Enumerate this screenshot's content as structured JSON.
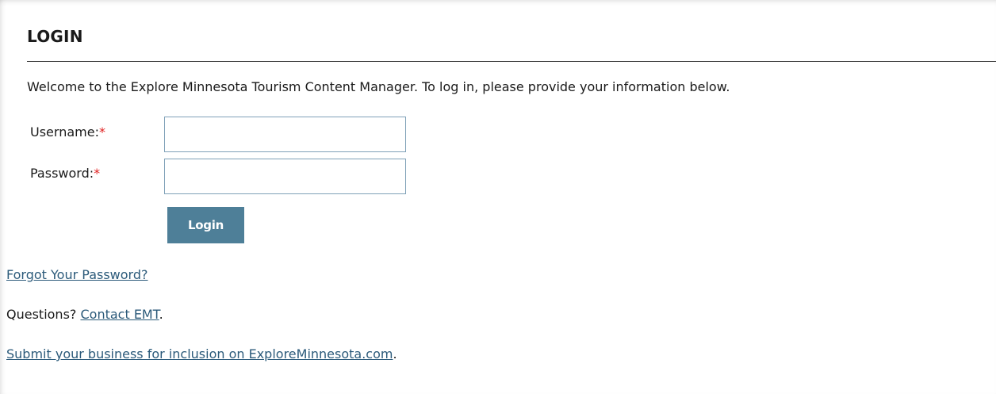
{
  "login": {
    "title": "LOGIN",
    "welcome_text": "Welcome to the Explore Minnesota Tourism Content Manager. To log in, please provide your information below.",
    "username_label": "Username:",
    "password_label": "Password:",
    "required_mark": "*",
    "username_value": "",
    "password_value": "",
    "login_button_label": "Login"
  },
  "links": {
    "forgot_password": "Forgot Your Password?",
    "questions_prefix": "Questions? ",
    "contact_link": "Contact EMT",
    "contact_suffix": ".",
    "submit_business_link": "Submit your business for inclusion on ExploreMinnesota.com",
    "submit_suffix": "."
  },
  "colors": {
    "button_background": "#4e7f98",
    "required_mark": "#e02020",
    "link": "#2b5a7a",
    "input_border": "#7fa1b8"
  }
}
